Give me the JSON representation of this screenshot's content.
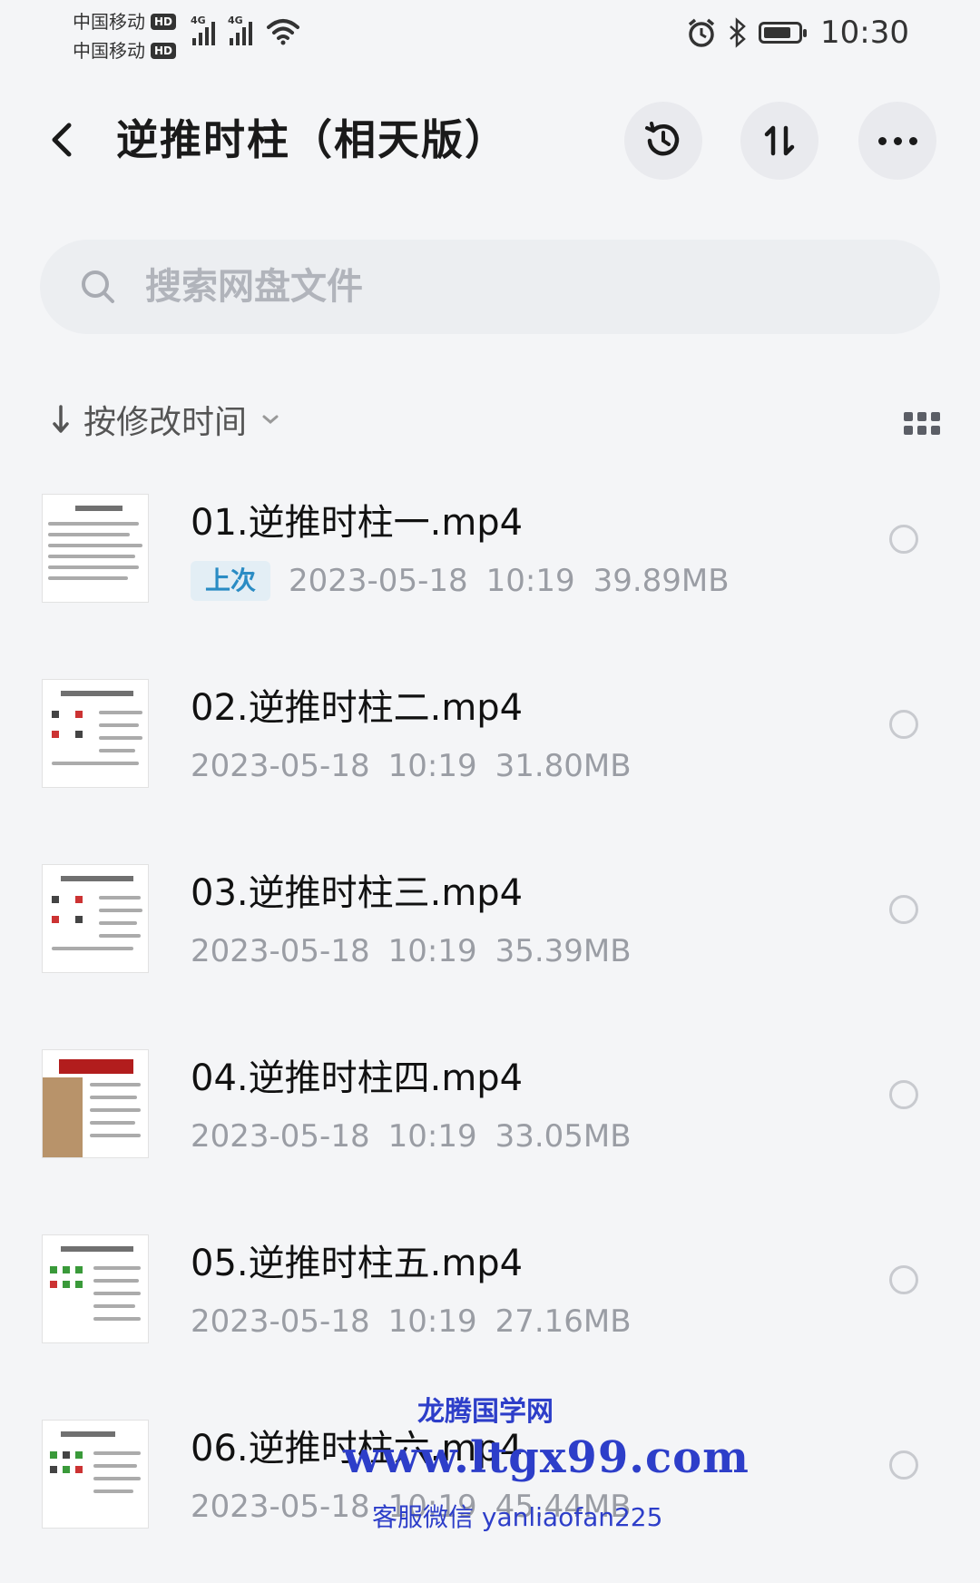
{
  "status_bar": {
    "carrier1": "中国移动",
    "carrier2": "中国移动",
    "hd": "HD",
    "network1": "4G",
    "network2": "4G",
    "time": "10:30",
    "battery_level": 0.8
  },
  "header": {
    "title": "逆推时柱（相天版）",
    "back_icon": "chevron-left-icon",
    "history_icon": "history-icon",
    "sort_icon": "sort-arrows-icon",
    "more_icon": "more-icon"
  },
  "search": {
    "placeholder": "搜索网盘文件"
  },
  "sort": {
    "label": "按修改时间"
  },
  "files": [
    {
      "name": "01.逆推时柱一.mp4",
      "badge": "上次",
      "date": "2023-05-18",
      "time": "10:19",
      "size": "39.89MB"
    },
    {
      "name": "02.逆推时柱二.mp4",
      "date": "2023-05-18",
      "time": "10:19",
      "size": "31.80MB"
    },
    {
      "name": "03.逆推时柱三.mp4",
      "date": "2023-05-18",
      "time": "10:19",
      "size": "35.39MB"
    },
    {
      "name": "04.逆推时柱四.mp4",
      "date": "2023-05-18",
      "time": "10:19",
      "size": "33.05MB"
    },
    {
      "name": "05.逆推时柱五.mp4",
      "date": "2023-05-18",
      "time": "10:19",
      "size": "27.16MB"
    },
    {
      "name": "06.逆推时柱六.mp4",
      "date": "2023-05-18",
      "time": "10:19",
      "size": "45.44MB"
    }
  ],
  "watermark": {
    "site": "龙腾国学网",
    "url": "www.ltgx99.com",
    "contact": "客服微信 yanliaofan225"
  },
  "colors": {
    "background": "#f4f5f7",
    "accent": "#2a8cc4",
    "watermark": "#2d3ec9"
  }
}
